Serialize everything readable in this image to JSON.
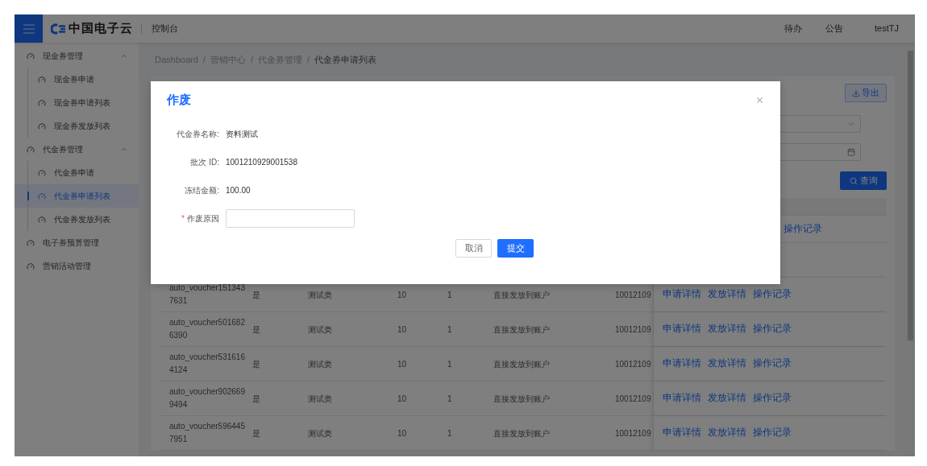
{
  "header": {
    "brand": "中国电子云",
    "console": "控制台",
    "nav": [
      "待办",
      "公告"
    ],
    "user": "testTJ"
  },
  "sidebar": {
    "items": [
      {
        "label": "现金券管理",
        "expanded": true,
        "children": [
          {
            "label": "现金券申请",
            "selected": false
          },
          {
            "label": "现金券申请列表",
            "selected": false
          },
          {
            "label": "现金券发放列表",
            "selected": false
          }
        ]
      },
      {
        "label": "代金券管理",
        "expanded": true,
        "children": [
          {
            "label": "代金券申请",
            "selected": false
          },
          {
            "label": "代金券申请列表",
            "selected": true
          },
          {
            "label": "代金券发放列表",
            "selected": false
          }
        ]
      },
      {
        "label": "电子券预算管理",
        "selected": false
      },
      {
        "label": "营销活动管理",
        "selected": false
      }
    ]
  },
  "breadcrumb": {
    "separator": "/",
    "items": [
      "Dashboard",
      "营销中心",
      "代金券管理",
      "代金券申请列表"
    ]
  },
  "toolbar": {
    "export_button": "导出",
    "query_button": "查询"
  },
  "table": {
    "partial_row_action": "操作记录",
    "rows": [
      {
        "name": "auto_voucher1513437631",
        "column_2": "是",
        "column_3": "测试类",
        "column_4": "10",
        "column_5": "1",
        "column_6": "直接发放到账户",
        "column_7": "10012109",
        "actions": [
          "申请详情",
          "发放详情",
          "操作记录"
        ]
      },
      {
        "name": "auto_voucher5016826390",
        "column_2": "是",
        "column_3": "测试类",
        "column_4": "10",
        "column_5": "1",
        "column_6": "直接发放到账户",
        "column_7": "10012109",
        "actions": [
          "申请详情",
          "发放详情",
          "操作记录"
        ]
      },
      {
        "name": "auto_voucher5316164124",
        "column_2": "是",
        "column_3": "测试类",
        "column_4": "10",
        "column_5": "1",
        "column_6": "直接发放到账户",
        "column_7": "10012109",
        "actions": [
          "申请详情",
          "发放详情",
          "操作记录"
        ]
      },
      {
        "name": "auto_voucher9026699494",
        "column_2": "是",
        "column_3": "测试类",
        "column_4": "10",
        "column_5": "1",
        "column_6": "直接发放到账户",
        "column_7": "10012109",
        "actions": [
          "申请详情",
          "发放详情",
          "操作记录"
        ]
      },
      {
        "name": "auto_voucher5964457951",
        "column_2": "是",
        "column_3": "测试类",
        "column_4": "10",
        "column_5": "1",
        "column_6": "直接发放到账户",
        "column_7": "10012109",
        "actions": [
          "申请详情",
          "发放详情",
          "操作记录"
        ]
      }
    ]
  },
  "dialog": {
    "title": "作废",
    "fields": [
      {
        "kind": "text",
        "label": "代金券名称:",
        "value": "资料测试"
      },
      {
        "kind": "text",
        "label": "批次 ID:",
        "value": "1001210929001538"
      },
      {
        "kind": "text",
        "label": "冻结金额:",
        "value": "100.00"
      },
      {
        "kind": "input",
        "label": "作废原因",
        "required_mark": "*"
      }
    ],
    "buttons": [
      {
        "kind": "default",
        "label": "取消"
      },
      {
        "kind": "primary",
        "label": "提交"
      }
    ]
  }
}
